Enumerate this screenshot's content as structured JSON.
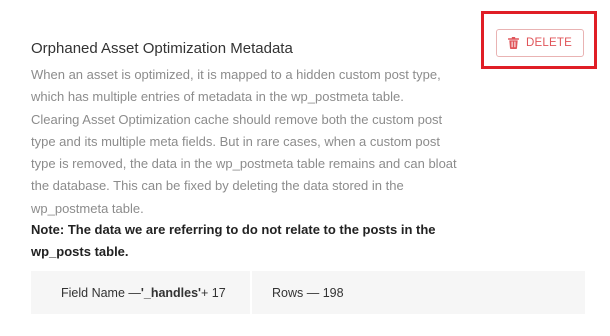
{
  "section": {
    "title": "Orphaned Asset Optimization Metadata",
    "description_lines": [
      "When an asset is optimized, it is mapped to a hidden custom post type,",
      "which has multiple entries of metadata in the wp_postmeta table.",
      "Clearing Asset Optimization cache should remove both the custom post",
      "type and its multiple meta fields. But in rare cases, when a custom post",
      "type is removed, the data in the wp_postmeta table remains and can bloat",
      "the database. This can be fixed by deleting the data stored in the",
      "wp_postmeta table."
    ],
    "note_lines": [
      "Note: The data we are referring to do not relate to the posts in the",
      "wp_posts table."
    ]
  },
  "delete_button": {
    "label": "DELETE",
    "icon": "trash-icon",
    "color": "#e0555a",
    "highlight_color": "#e01e26"
  },
  "info": {
    "field_prefix": "Field Name — ",
    "field_name": "'_handles'",
    "field_suffix": " + 17",
    "rows_text": "Rows — 198"
  }
}
